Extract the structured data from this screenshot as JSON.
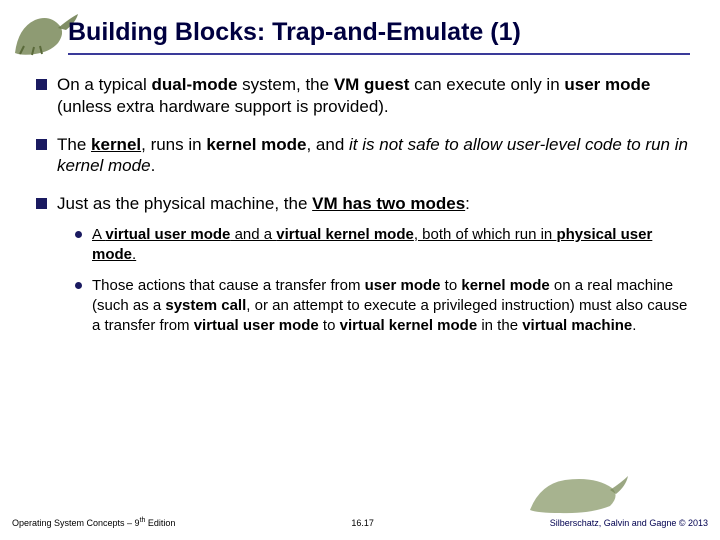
{
  "title": "Building Blocks: Trap-and-Emulate (1)",
  "bullets": {
    "b1_pre": "On a typical ",
    "b1_dm": "dual-mode",
    "b1_mid1": " system, the ",
    "b1_vg": "VM guest",
    "b1_mid2": " can execute only in ",
    "b1_um": "user mode",
    "b1_tail": " (unless extra hardware support is provided).",
    "b2_pre": "The ",
    "b2_kernel": "kernel",
    "b2_mid1": ", runs in ",
    "b2_km": "kernel mode",
    "b2_mid2": ", and ",
    "b2_ital": "it is not safe to allow user-level code to run in kernel mode",
    "b2_tail": ".",
    "b3_pre": "Just as the physical machine, the ",
    "b3_bold": "VM has two modes",
    "b3_tail": ":",
    "s1_pre": "A ",
    "s1_vum": "virtual user mode",
    "s1_mid1": " and a ",
    "s1_vkm": "virtual kernel mode",
    "s1_mid2": ", both of which run in ",
    "s1_pum": "physical user mode",
    "s1_tail": ".",
    "s2_p1": "Those actions that cause a transfer from ",
    "s2_um": "user mode",
    "s2_p2": " to ",
    "s2_km": "kernel mode",
    "s2_p3": " on a real machine (such as a ",
    "s2_sc": "system call",
    "s2_p4": ", or an attempt to execute a privileged instruction) must also cause a transfer from ",
    "s2_vum": "virtual user mode",
    "s2_p5": " to ",
    "s2_vkm": "virtual kernel mode",
    "s2_p6": " in the ",
    "s2_vm": "virtual machine",
    "s2_tail": "."
  },
  "footer": {
    "left_a": "Operating System Concepts – 9",
    "left_b": " Edition",
    "left_sup": "th",
    "center": "16.17",
    "right": "Silberschatz, Galvin and Gagne © 2013"
  }
}
